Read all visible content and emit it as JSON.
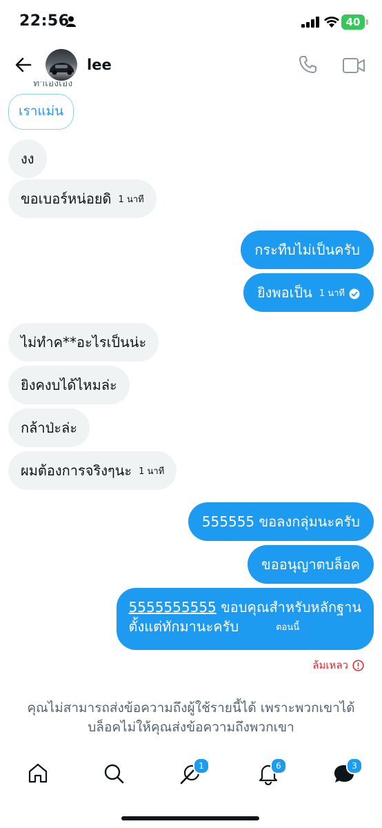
{
  "status": {
    "time": "22:56",
    "battery": "40"
  },
  "header": {
    "contact_name": "lee",
    "clipped_text": "ทำเองเอง"
  },
  "quick_reply": "เราแม่น",
  "messages": [
    {
      "dir": "in",
      "text": "งง",
      "time": ""
    },
    {
      "dir": "in",
      "text": "ขอเบอร์หน่อยดิ",
      "time": "1 นาที"
    },
    {
      "dir": "out",
      "text": "กระทืบไม่เป็นครับ",
      "time": ""
    },
    {
      "dir": "out",
      "text": "ยิงพอเป็น",
      "time": "1 นาที"
    },
    {
      "dir": "in",
      "text": "ไม่ทำค**อะไรเป็นน่ะ",
      "time": ""
    },
    {
      "dir": "in",
      "text": "ยิงคงบได้ไหมล่ะ",
      "time": ""
    },
    {
      "dir": "in",
      "text": "กล้าป่ะล่ะ",
      "time": ""
    },
    {
      "dir": "in",
      "text": "ผมต้องการจริงๆนะ",
      "time": "1 นาที"
    },
    {
      "dir": "out",
      "text": "555555 ขอลงกลุ่มนะครับ",
      "time": ""
    },
    {
      "dir": "out",
      "text": "ขออนุญาตบล็อค",
      "time": ""
    }
  ],
  "last_message": {
    "link": "5555555555",
    "line1": " ขอบคุณสำหรับหลักฐาน",
    "line2": "ตั้งแต่ทักมานะครับ",
    "time": "ตอนนี้"
  },
  "failed_label": "ล้มเหลว",
  "blocked_notice": "คุณไม่สามารถส่งข้อความถึงผู้ใช้รายนี้ได้ เพราะพวกเขาได้บล็อคไม่ให้คุณส่งข้อความถึงพวกเขา",
  "nav": {
    "badges": {
      "spaces": "1",
      "notifications": "6",
      "messages": "3"
    }
  },
  "colors": {
    "accent": "#1d9bf0",
    "incoming_bg": "#eff3f4",
    "error": "#f4212e",
    "battery": "#34c759"
  }
}
